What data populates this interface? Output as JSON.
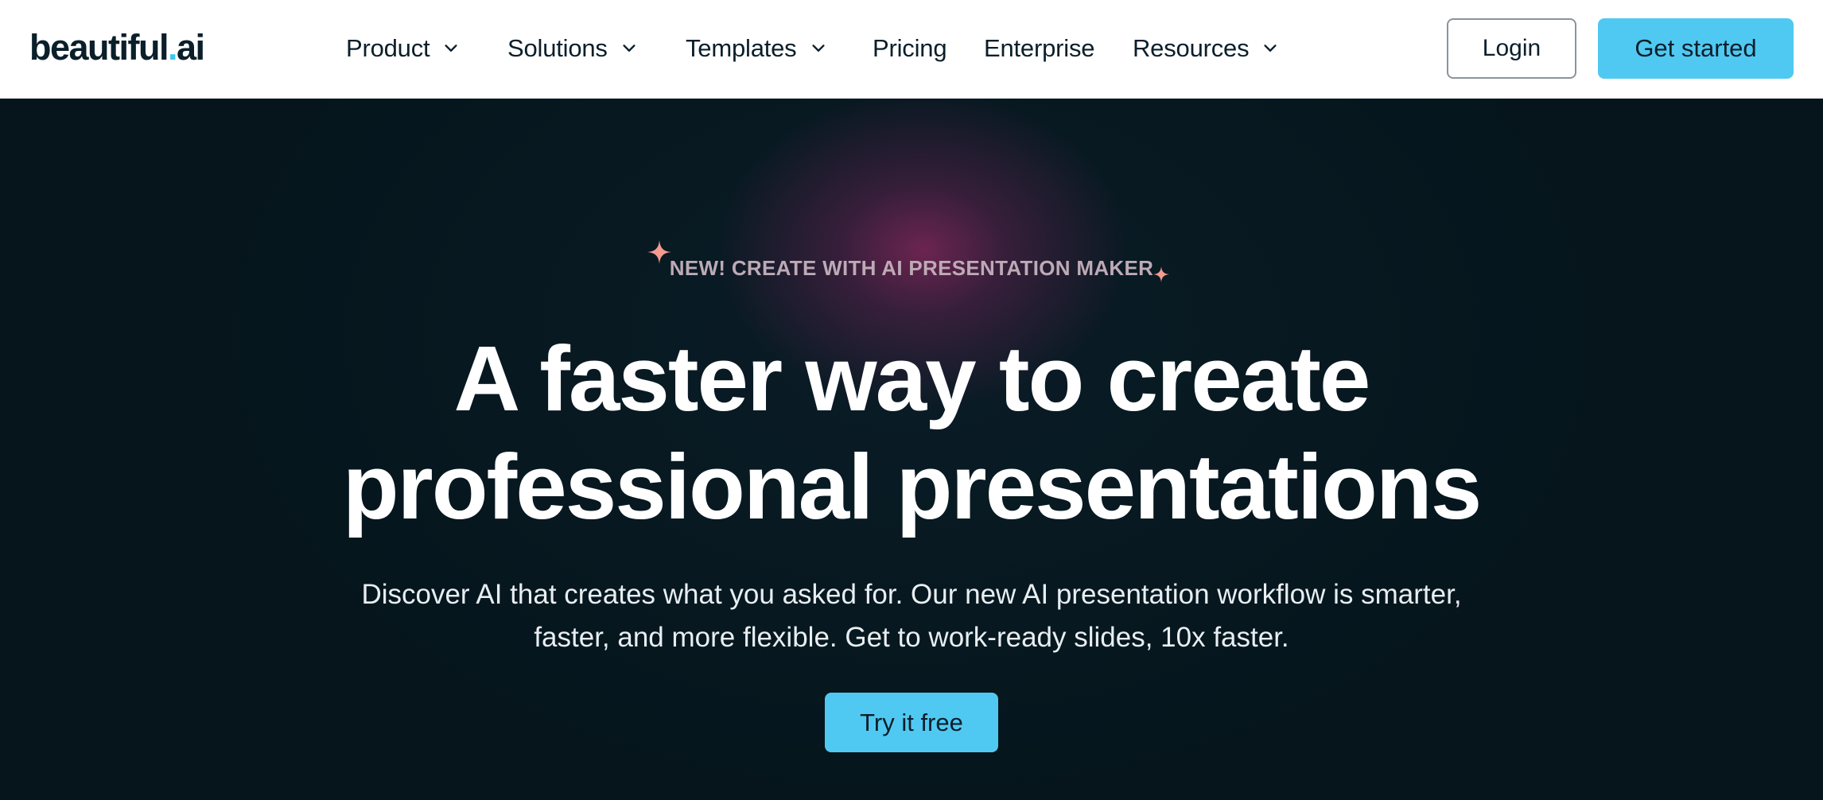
{
  "brand": {
    "logo_main": "beautiful",
    "logo_dot": ".",
    "logo_tld": "ai",
    "accent_color": "#50c9f2",
    "dark_bg": "#071820"
  },
  "nav": {
    "items": [
      {
        "label": "Product",
        "has_dropdown": true,
        "icon": "chevron-down-icon"
      },
      {
        "label": "Solutions",
        "has_dropdown": true,
        "icon": "chevron-down-icon"
      },
      {
        "label": "Templates",
        "has_dropdown": true,
        "icon": "chevron-down-icon"
      },
      {
        "label": "Pricing",
        "has_dropdown": false
      },
      {
        "label": "Enterprise",
        "has_dropdown": false
      },
      {
        "label": "Resources",
        "has_dropdown": true,
        "icon": "chevron-down-icon"
      }
    ],
    "login_label": "Login",
    "get_started_label": "Get started"
  },
  "hero": {
    "badge": "NEW! CREATE WITH AI PRESENTATION MAKER",
    "badge_icons": [
      "sparkle-icon",
      "sparkle-icon"
    ],
    "headline_line1": "A faster way to create",
    "headline_line2": "professional presentations",
    "subtext_line1": "Discover AI that creates what you asked for. Our new AI presentation workflow is smarter,",
    "subtext_line2": "faster, and more flexible. Get to work-ready slides, 10x faster.",
    "cta_label": "Try it free"
  }
}
